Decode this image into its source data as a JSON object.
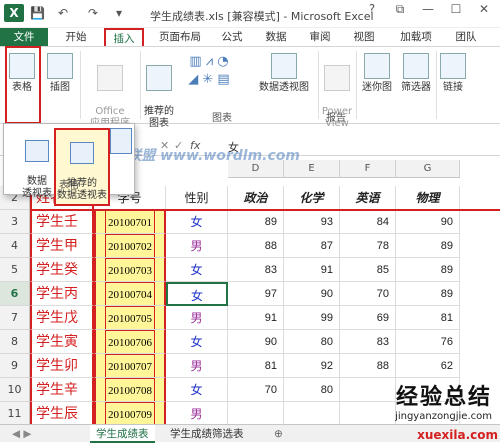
{
  "window": {
    "title": "学生成绩表.xls  [兼容模式] - Microsoft Excel",
    "icon": "excel-icon",
    "controls": [
      "?",
      "⧉",
      "—",
      "☐",
      "✕"
    ]
  },
  "tabs": [
    {
      "label": "文件"
    },
    {
      "label": "开始"
    },
    {
      "label": "插入"
    },
    {
      "label": "页面布局"
    },
    {
      "label": "公式"
    },
    {
      "label": "数据"
    },
    {
      "label": "审阅"
    },
    {
      "label": "视图"
    },
    {
      "label": "加载项"
    },
    {
      "label": "团队"
    }
  ],
  "ribbon": {
    "table": "表格",
    "illustrations": "插图",
    "office_apps": "Office\n应用程序",
    "recommended_charts": "推荐的\n图表",
    "pivot_chart": "数据透视图",
    "power_view": "Power\nView",
    "sparklines": "迷你图",
    "slicer": "筛选器",
    "link": "链接",
    "group_chart": "图表",
    "group_report": "报告"
  },
  "dropdown": {
    "pivot_table": "数据\n透视表",
    "recommended_pivot": "推荐的\n数据透视表",
    "group_label": "表格"
  },
  "formula": {
    "fx": "fx",
    "value": "女"
  },
  "grid": {
    "columns": [
      "D",
      "E",
      "F",
      "G"
    ],
    "header_row": {
      "sid": "学号",
      "gender": "性别",
      "politics": "政治",
      "chemistry": "化学",
      "english": "英语",
      "physics": "物理"
    },
    "rows": [
      {
        "num": "2",
        "name": "姓名",
        "sid": "学号",
        "gender": "性别",
        "politics": "政治",
        "chemistry": "化学",
        "english": "英语",
        "physics": "物理"
      },
      {
        "num": "3",
        "name": "学生壬",
        "sid": "20100701",
        "gender": "女",
        "politics": "89",
        "chemistry": "93",
        "english": "84",
        "physics": "90"
      },
      {
        "num": "4",
        "name": "学生甲",
        "sid": "20100702",
        "gender": "男",
        "politics": "88",
        "chemistry": "87",
        "english": "78",
        "physics": "89"
      },
      {
        "num": "5",
        "name": "学生癸",
        "sid": "20100703",
        "gender": "女",
        "politics": "83",
        "chemistry": "91",
        "english": "85",
        "physics": "89"
      },
      {
        "num": "6",
        "name": "学生丙",
        "sid": "20100704",
        "gender": "女",
        "politics": "97",
        "chemistry": "90",
        "english": "70",
        "physics": "89"
      },
      {
        "num": "7",
        "name": "学生戊",
        "sid": "20100705",
        "gender": "男",
        "politics": "91",
        "chemistry": "99",
        "english": "69",
        "physics": "81"
      },
      {
        "num": "8",
        "name": "学生寅",
        "sid": "20100706",
        "gender": "女",
        "politics": "90",
        "chemistry": "80",
        "english": "83",
        "physics": "76"
      },
      {
        "num": "9",
        "name": "学生卯",
        "sid": "20100707",
        "gender": "男",
        "politics": "81",
        "chemistry": "92",
        "english": "88",
        "physics": "62"
      },
      {
        "num": "10",
        "name": "学生辛",
        "sid": "20100708",
        "gender": "女",
        "politics": "70",
        "chemistry": "80",
        "english": "",
        "physics": ""
      },
      {
        "num": "11",
        "name": "学生辰",
        "sid": "20100709",
        "gender": "男",
        "politics": "",
        "chemistry": "",
        "english": "",
        "physics": ""
      }
    ]
  },
  "sheets": [
    {
      "label": "学生成绩表"
    },
    {
      "label": "学生成绩筛选表"
    }
  ],
  "watermark": {
    "big": "经验总结",
    "small": "jingyanzongjie.com",
    "corner": "xuexila.com",
    "blur": "Word联盟 www.wordlm.com"
  }
}
